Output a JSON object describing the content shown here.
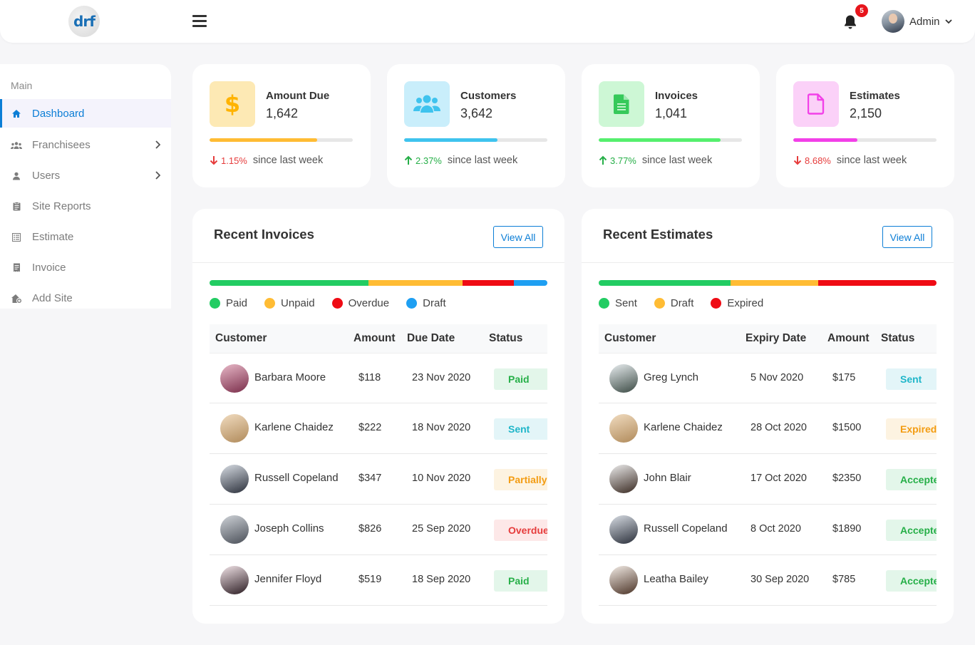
{
  "header": {
    "logo_text": "drf",
    "notification_count": "5",
    "user_name": "Admin"
  },
  "sidebar": {
    "section_title": "Main",
    "items": [
      {
        "label": "Dashboard",
        "icon": "home-icon",
        "active": true
      },
      {
        "label": "Franchisees",
        "icon": "users-group-icon",
        "has_submenu": true
      },
      {
        "label": "Users",
        "icon": "user-icon",
        "has_submenu": true
      },
      {
        "label": "Site Reports",
        "icon": "clipboard-icon"
      },
      {
        "label": "Estimate",
        "icon": "list-icon"
      },
      {
        "label": "Invoice",
        "icon": "receipt-icon"
      },
      {
        "label": "Add Site",
        "icon": "add-site-icon"
      }
    ]
  },
  "stats": [
    {
      "label": "Amount Due",
      "value": "1,642",
      "trend": "1.15%",
      "direction": "down",
      "since": "since last week",
      "progress": 0.75,
      "color": "#ffbc34",
      "icon_bg": "#fde9b4",
      "icon": "dollar-icon"
    },
    {
      "label": "Customers",
      "value": "3,642",
      "trend": "2.37%",
      "direction": "up",
      "since": "since last week",
      "progress": 0.65,
      "color": "#3fc3ee",
      "icon_bg": "#c9eefb",
      "icon": "users-icon"
    },
    {
      "label": "Invoices",
      "value": "1,041",
      "trend": "3.77%",
      "direction": "up",
      "since": "since last week",
      "progress": 0.85,
      "color": "#55ef6e",
      "icon_bg": "#cdf7d5",
      "icon": "file-text-icon"
    },
    {
      "label": "Estimates",
      "value": "2,150",
      "trend": "8.68%",
      "direction": "down",
      "since": "since last week",
      "progress": 0.45,
      "color": "#f240e8",
      "icon_bg": "#fbd1f8",
      "icon": "file-icon"
    }
  ],
  "invoices": {
    "title": "Recent Invoices",
    "view_all": "View All",
    "bar": [
      {
        "name": "Paid",
        "share": 0.47,
        "color": "#22cc62"
      },
      {
        "name": "Unpaid",
        "share": 0.28,
        "color": "#ffbc34"
      },
      {
        "name": "Overdue",
        "share": 0.15,
        "color": "#ef0b14"
      },
      {
        "name": "Draft",
        "share": 0.1,
        "color": "#1e9ff2"
      }
    ],
    "columns": [
      "Customer",
      "Amount",
      "Due Date",
      "Status"
    ],
    "rows": [
      {
        "name": "Barbara Moore",
        "amount": "$118",
        "date": "23 Nov 2020",
        "status": "Paid",
        "status_class": "st-paid"
      },
      {
        "name": "Karlene Chaidez",
        "amount": "$222",
        "date": "18 Nov 2020",
        "status": "Sent",
        "status_class": "st-sent"
      },
      {
        "name": "Russell Copeland",
        "amount": "$347",
        "date": "10 Nov 2020",
        "status": "Partially",
        "status_class": "st-partial"
      },
      {
        "name": "Joseph Collins",
        "amount": "$826",
        "date": "25 Sep 2020",
        "status": "Overdue",
        "status_class": "st-overdue"
      },
      {
        "name": "Jennifer Floyd",
        "amount": "$519",
        "date": "18 Sep 2020",
        "status": "Paid",
        "status_class": "st-paid"
      }
    ]
  },
  "estimates": {
    "title": "Recent Estimates",
    "view_all": "View All",
    "bar": [
      {
        "name": "Sent",
        "share": 0.39,
        "color": "#22cc62"
      },
      {
        "name": "Draft",
        "share": 0.26,
        "color": "#ffbc34"
      },
      {
        "name": "Expired",
        "share": 0.35,
        "color": "#ef0b14"
      }
    ],
    "columns": [
      "Customer",
      "Expiry Date",
      "Amount",
      "Status"
    ],
    "rows": [
      {
        "name": "Greg Lynch",
        "date": "5 Nov 2020",
        "amount": "$175",
        "status": "Sent",
        "status_class": "st-sent"
      },
      {
        "name": "Karlene Chaidez",
        "date": "28 Oct 2020",
        "amount": "$1500",
        "status": "Expired",
        "status_class": "st-expired"
      },
      {
        "name": "John Blair",
        "date": "17 Oct 2020",
        "amount": "$2350",
        "status": "Accepted",
        "status_class": "st-accepted"
      },
      {
        "name": "Russell Copeland",
        "date": "8 Oct 2020",
        "amount": "$1890",
        "status": "Accepted",
        "status_class": "st-accepted"
      },
      {
        "name": "Leatha Bailey",
        "date": "30 Sep 2020",
        "amount": "$785",
        "status": "Accepted",
        "status_class": "st-accepted"
      }
    ]
  }
}
